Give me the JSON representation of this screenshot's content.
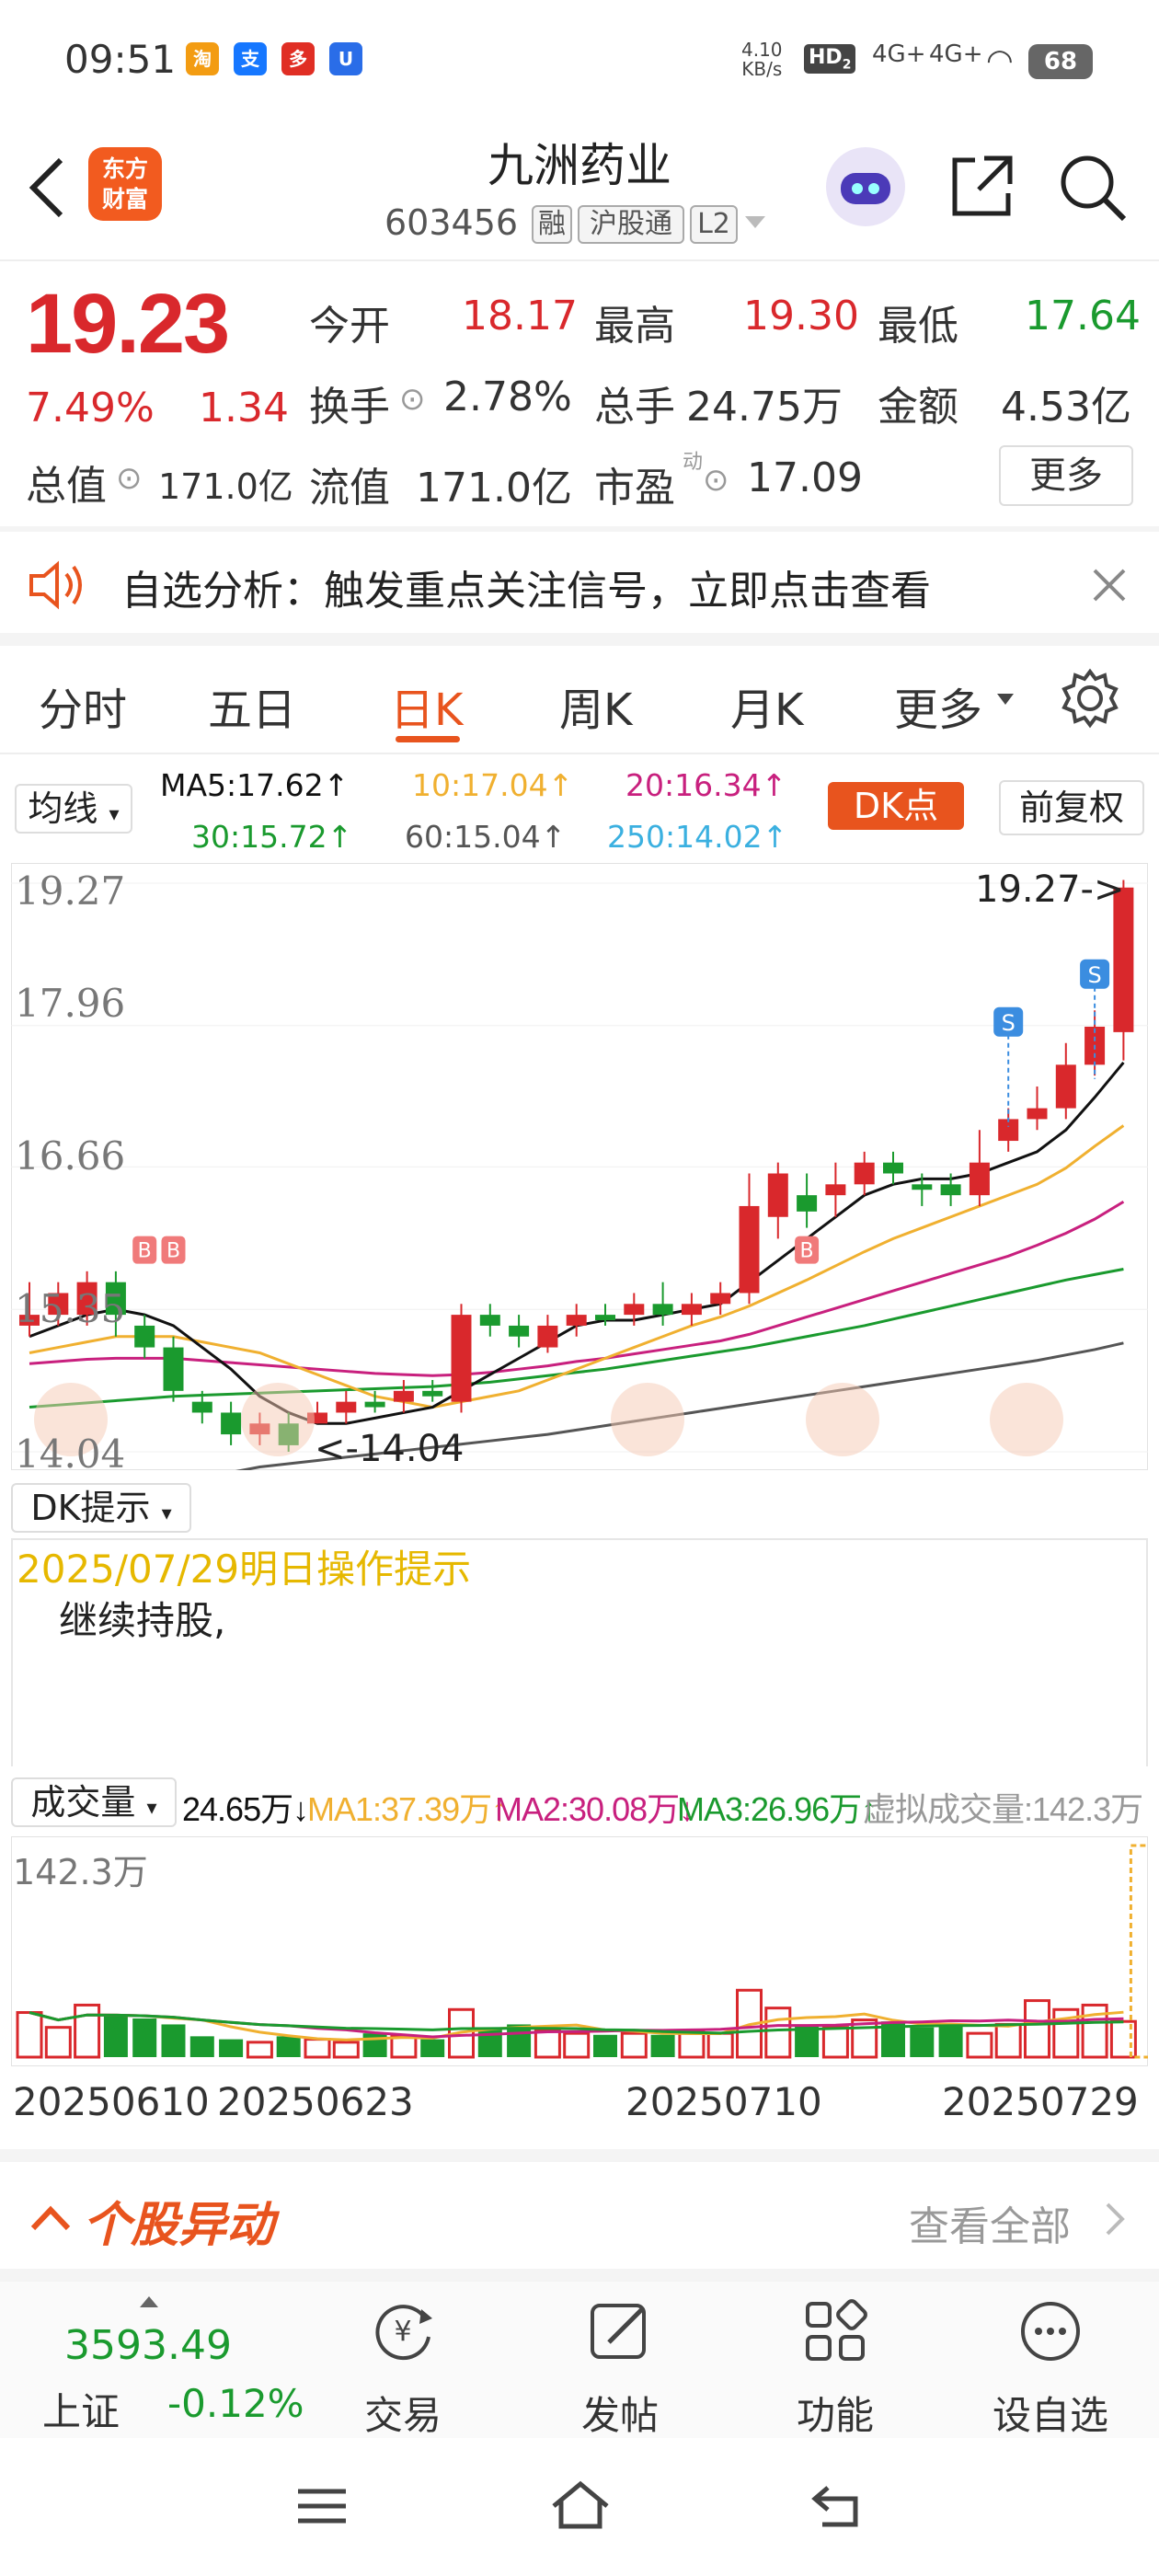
{
  "status_bar": {
    "time": "09:51",
    "net_speed_top": "4.10",
    "net_speed_bottom": "KB/s",
    "hd": "HD",
    "hd_sub": "2",
    "sig1": "4G+",
    "sig2": "4G+",
    "battery": "68",
    "apps": [
      "淘",
      "支",
      "多",
      "U"
    ]
  },
  "header": {
    "title": "九洲药业",
    "code": "603456",
    "tags": [
      "融",
      "沪股通",
      "L2"
    ],
    "logo_line1": "东方",
    "logo_line2": "财富"
  },
  "quote": {
    "price": "19.23",
    "change_pct": "7.49%",
    "change": "1.34",
    "open_label": "今开",
    "open": "18.17",
    "high_label": "最高",
    "high": "19.30",
    "low_label": "最低",
    "low": "17.64",
    "turnover_label": "换手",
    "turnover": "2.78%",
    "volume_label": "总手",
    "volume": "24.75万",
    "amount_label": "金额",
    "amount": "4.53亿",
    "mktcap_label": "总值",
    "mktcap": "171.0亿",
    "float_label": "流值",
    "float": "171.0亿",
    "pe_label": "市盈",
    "pe_sup": "动",
    "pe": "17.09",
    "more": "更多"
  },
  "banner": {
    "text": "自选分析：触发重点关注信号，立即点击查看"
  },
  "tabs": [
    "分时",
    "五日",
    "日K",
    "周K",
    "月K",
    "更多"
  ],
  "active_tab": 2,
  "ma_row": {
    "selector": "均线",
    "ma5": "MA5:17.62↑",
    "ma10": "10:17.04↑",
    "ma20": "20:16.34↑",
    "ma30": "30:15.72↑",
    "ma60": "60:15.04↑",
    "ma250": "250:14.02↑",
    "dk": "DK点",
    "adjust": "前复权"
  },
  "kchart": {
    "y_labels": [
      "19.27",
      "17.96",
      "16.66",
      "15.35",
      "14.04"
    ],
    "max_label": "19.27->",
    "min_label": "<-14.04",
    "ylim": [
      14.04,
      19.27
    ],
    "candles": [
      [
        15.2,
        15.3,
        15.6,
        15.1
      ],
      [
        15.3,
        15.5,
        15.6,
        15.2
      ],
      [
        15.3,
        15.6,
        15.7,
        15.2
      ],
      [
        15.6,
        15.3,
        15.7,
        15.1
      ],
      [
        15.2,
        15.0,
        15.3,
        14.9
      ],
      [
        15.0,
        14.6,
        15.1,
        14.5
      ],
      [
        14.5,
        14.4,
        14.6,
        14.3
      ],
      [
        14.4,
        14.2,
        14.5,
        14.1
      ],
      [
        14.2,
        14.3,
        14.4,
        14.1
      ],
      [
        14.3,
        14.1,
        14.4,
        14.04
      ],
      [
        14.3,
        14.4,
        14.5,
        14.3
      ],
      [
        14.4,
        14.5,
        14.6,
        14.3
      ],
      [
        14.5,
        14.45,
        14.6,
        14.4
      ],
      [
        14.5,
        14.6,
        14.7,
        14.4
      ],
      [
        14.6,
        14.55,
        14.7,
        14.5
      ],
      [
        14.5,
        15.3,
        15.4,
        14.4
      ],
      [
        15.3,
        15.2,
        15.4,
        15.1
      ],
      [
        15.2,
        15.1,
        15.3,
        15.0
      ],
      [
        15.0,
        15.2,
        15.3,
        14.95
      ],
      [
        15.2,
        15.3,
        15.4,
        15.1
      ],
      [
        15.3,
        15.25,
        15.4,
        15.2
      ],
      [
        15.3,
        15.4,
        15.5,
        15.2
      ],
      [
        15.4,
        15.3,
        15.6,
        15.2
      ],
      [
        15.3,
        15.4,
        15.5,
        15.2
      ],
      [
        15.4,
        15.5,
        15.6,
        15.3
      ],
      [
        15.5,
        16.3,
        16.6,
        15.4
      ],
      [
        16.2,
        16.6,
        16.7,
        16.0
      ],
      [
        16.4,
        16.25,
        16.6,
        16.1
      ],
      [
        16.4,
        16.5,
        16.7,
        16.2
      ],
      [
        16.5,
        16.7,
        16.8,
        16.4
      ],
      [
        16.7,
        16.6,
        16.8,
        16.5
      ],
      [
        16.5,
        16.45,
        16.6,
        16.3
      ],
      [
        16.5,
        16.4,
        16.6,
        16.3
      ],
      [
        16.4,
        16.7,
        17.0,
        16.3
      ],
      [
        16.9,
        17.1,
        17.2,
        16.8
      ],
      [
        17.1,
        17.2,
        17.4,
        17.0
      ],
      [
        17.2,
        17.6,
        17.8,
        17.1
      ],
      [
        17.6,
        17.95,
        18.1,
        17.5
      ],
      [
        17.9,
        19.23,
        19.3,
        17.64
      ]
    ],
    "ma5": [
      15.1,
      15.2,
      15.3,
      15.35,
      15.3,
      15.2,
      15.0,
      14.8,
      14.55,
      14.4,
      14.3,
      14.3,
      14.35,
      14.4,
      14.45,
      14.6,
      14.75,
      14.9,
      15.05,
      15.2,
      15.25,
      15.25,
      15.3,
      15.35,
      15.4,
      15.6,
      15.8,
      16.0,
      16.2,
      16.4,
      16.5,
      16.55,
      16.55,
      16.6,
      16.7,
      16.8,
      17.0,
      17.3,
      17.62
    ],
    "ma10": [
      14.95,
      15.0,
      15.05,
      15.1,
      15.1,
      15.1,
      15.05,
      15.0,
      14.95,
      14.85,
      14.75,
      14.65,
      14.55,
      14.5,
      14.45,
      14.5,
      14.55,
      14.6,
      14.7,
      14.8,
      14.9,
      15.0,
      15.1,
      15.2,
      15.28,
      15.38,
      15.5,
      15.62,
      15.75,
      15.88,
      16.0,
      16.1,
      16.2,
      16.3,
      16.4,
      16.5,
      16.65,
      16.85,
      17.04
    ],
    "ma20": [
      14.85,
      14.87,
      14.89,
      14.9,
      14.9,
      14.9,
      14.88,
      14.86,
      14.84,
      14.82,
      14.8,
      14.78,
      14.76,
      14.75,
      14.74,
      14.75,
      14.77,
      14.8,
      14.83,
      14.87,
      14.9,
      14.94,
      14.98,
      15.02,
      15.06,
      15.12,
      15.2,
      15.28,
      15.36,
      15.44,
      15.52,
      15.6,
      15.68,
      15.76,
      15.84,
      15.94,
      16.05,
      16.18,
      16.34
    ],
    "ma30": [
      14.45,
      14.47,
      14.49,
      14.51,
      14.53,
      14.55,
      14.56,
      14.57,
      14.58,
      14.59,
      14.6,
      14.61,
      14.62,
      14.63,
      14.64,
      14.66,
      14.68,
      14.71,
      14.74,
      14.77,
      14.8,
      14.84,
      14.88,
      14.92,
      14.96,
      15.0,
      15.05,
      15.1,
      15.15,
      15.2,
      15.26,
      15.32,
      15.38,
      15.44,
      15.5,
      15.56,
      15.62,
      15.67,
      15.72
    ],
    "ma60": [
      13.5,
      13.55,
      13.6,
      13.65,
      13.7,
      13.75,
      13.8,
      13.85,
      13.9,
      13.93,
      13.96,
      13.99,
      14.02,
      14.05,
      14.08,
      14.11,
      14.14,
      14.17,
      14.2,
      14.24,
      14.28,
      14.32,
      14.36,
      14.4,
      14.44,
      14.48,
      14.52,
      14.56,
      14.6,
      14.64,
      14.68,
      14.72,
      14.76,
      14.8,
      14.84,
      14.88,
      14.93,
      14.98,
      15.04
    ]
  },
  "dk_tip": {
    "selector": "DK提示",
    "date_line": "2025/07/29明日操作提示",
    "body": "继续持股,"
  },
  "volume": {
    "selector": "成交量",
    "cur": "24.65万↓",
    "ma1": "MA1:37.39万↑",
    "ma2": "MA2:30.08万↓",
    "ma3": "MA3:26.96万↑",
    "virtual": "虚拟成交量:142.3万",
    "max_label": "142.3万",
    "dates": [
      "20250610",
      "20250623",
      "20250710",
      "20250729"
    ],
    "bars": [
      30,
      20,
      35,
      28,
      26,
      22,
      14,
      12,
      10,
      14,
      12,
      10,
      16,
      14,
      12,
      32,
      20,
      22,
      18,
      16,
      15,
      16,
      15,
      17,
      16,
      45,
      33,
      22,
      20,
      25,
      24,
      20,
      22,
      16,
      22,
      38,
      32,
      35,
      24
    ],
    "ylim": [
      0,
      142.3
    ]
  },
  "section": {
    "title": "个股异动",
    "see_all": "查看全部"
  },
  "bottom_nav": {
    "index_value": "3593.49",
    "index_name": "上证",
    "index_change": "-0.12%",
    "items": [
      "交易",
      "发帖",
      "功能",
      "设自选"
    ]
  },
  "colors": {
    "up": "#d9282c",
    "down": "#1a9a2e",
    "accent": "#e8541e",
    "ma5": "#111111",
    "ma10": "#f0b030",
    "ma20": "#c8207e",
    "ma30": "#1a9a2e",
    "ma60": "#555555"
  }
}
